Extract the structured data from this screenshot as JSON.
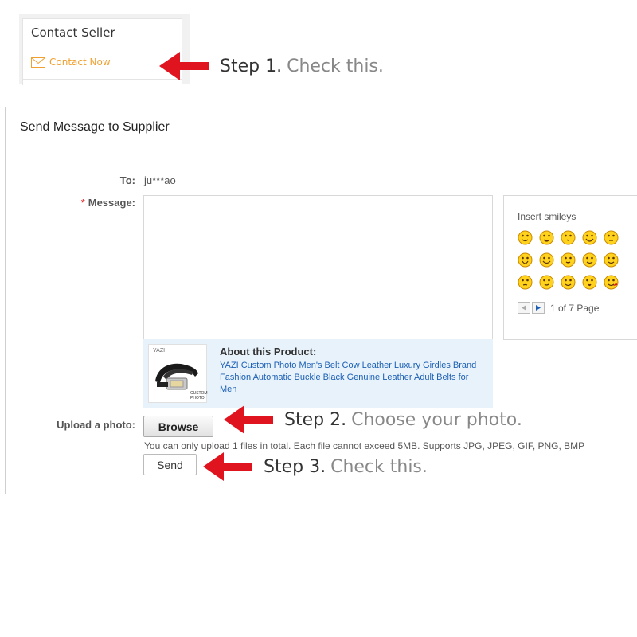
{
  "contact_seller": {
    "title": "Contact Seller",
    "contact_now_label": "Contact Now"
  },
  "steps": [
    {
      "number": "Step 1.",
      "text": "Check this."
    },
    {
      "number": "Step 2.",
      "text": "Choose your photo."
    },
    {
      "number": "Step 3.",
      "text": "Check this."
    }
  ],
  "form": {
    "title": "Send Message to Supplier",
    "to_label": "To:",
    "to_value": "ju***ao",
    "message_label": "Message:",
    "required_mark": "*",
    "message_value": "",
    "product": {
      "about_label": "About this Product:",
      "name": "YAZI Custom Photo Men's Belt Cow Leather Luxury Girdles Brand Fashion Automatic Buckle Black Genuine Leather Adult Belts for Men",
      "thumb_brand": "YAZI",
      "thumb_caption": "CUSTOM PHOTO"
    },
    "upload_label": "Upload a photo:",
    "browse_label": "Browse",
    "upload_hint": "You can only upload 1 files in total. Each file cannot exceed 5MB. Supports JPG, JPEG, GIF, PNG, BMP",
    "send_label": "Send"
  },
  "smileys": {
    "title": "Insert smileys",
    "icons": [
      "smile-icon",
      "wink-tongue-icon",
      "kiss-icon",
      "laugh-icon",
      "sleepy-icon",
      "shout-icon",
      "rofl-icon",
      "blush-icon",
      "hug-icon",
      "flower-icon",
      "think-icon",
      "shy-icon",
      "cool-icon",
      "surprised-icon",
      "love-icon"
    ],
    "pager_text": "1 of 7 Page"
  },
  "colors": {
    "arrow": "#e0141e",
    "link": "#1a5fb4",
    "contact_now": "#f0a030",
    "product_bg": "#e8f2fb"
  }
}
